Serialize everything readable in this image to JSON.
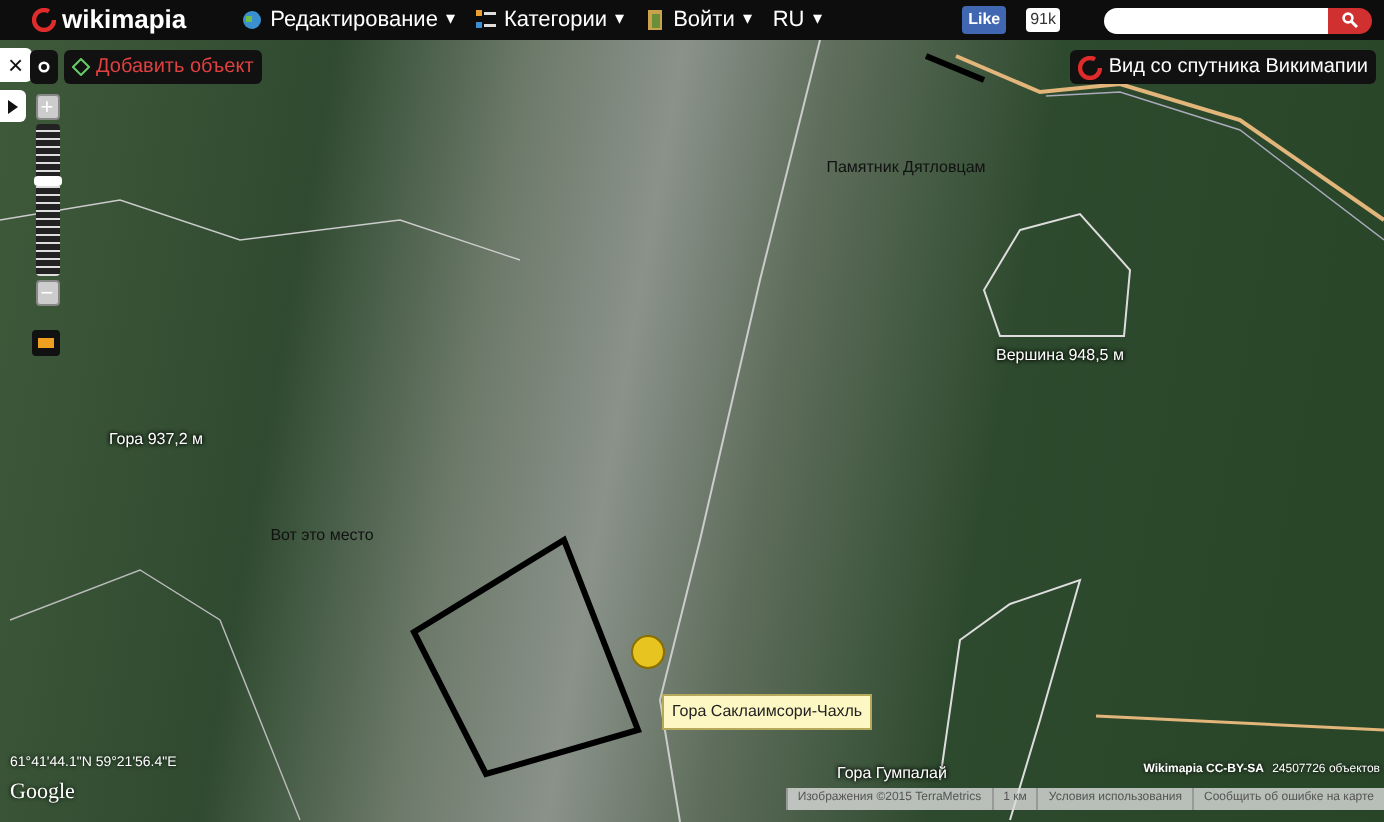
{
  "header": {
    "logo": "wikimapia",
    "menu": [
      {
        "label": "Редактирование",
        "caret": "▾"
      },
      {
        "label": "Категории",
        "caret": "▾"
      },
      {
        "label": "Войти",
        "caret": "▾"
      },
      {
        "label": "RU",
        "caret": "▾"
      }
    ],
    "like": {
      "label": "Like",
      "count": "91k"
    }
  },
  "toolbar": {
    "close": "×",
    "add_object": "Добавить объект",
    "satellite": "Вид со спутника Викимапии"
  },
  "zoom": {
    "plus": "+",
    "minus": "−",
    "level": 0.63
  },
  "map_labels": [
    {
      "kind": "plain",
      "text": "Памятник Дятловцам"
    },
    {
      "kind": "outlined",
      "text": "Вершина 948,5 м"
    },
    {
      "kind": "outlined",
      "text": "Гора 937,2 м"
    },
    {
      "kind": "plain",
      "text": "Вот это место"
    },
    {
      "kind": "tooltip",
      "text": "Гора Саклаимсори-Чахль"
    },
    {
      "kind": "outlined",
      "text": "Гора Гумпалай"
    }
  ],
  "coordinates": "61°41'44.1\"N 59°21'56.4\"E",
  "google": "Google",
  "license": "Wikimapia CC-BY-SA",
  "object_count": "24507726 объектов",
  "footer": [
    "Изображения ©2015 TerraMetrics",
    "1 км",
    "Условия использования",
    "Сообщить об ошибке на карте"
  ]
}
